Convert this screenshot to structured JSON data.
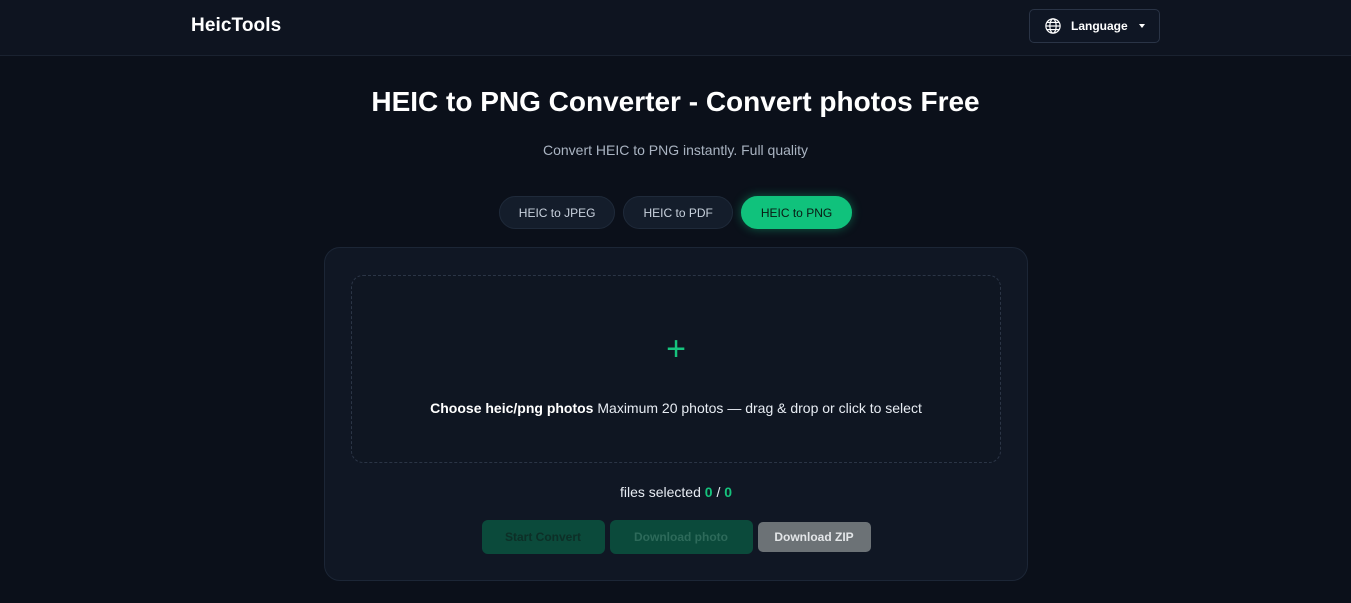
{
  "header": {
    "logo": "HeicTools",
    "language_label": "Language",
    "globe_icon": "globe-icon",
    "caret_icon": "caret-down-icon"
  },
  "hero": {
    "title": "HEIC to PNG Converter - Convert photos Free",
    "subtitle": "Convert HEIC to PNG instantly. Full quality"
  },
  "tabs": [
    {
      "label": "HEIC to JPEG",
      "active": false
    },
    {
      "label": "HEIC to PDF",
      "active": false
    },
    {
      "label": "HEIC to PNG",
      "active": true
    }
  ],
  "dropzone": {
    "plus_icon": "+",
    "bold_text": "Choose heic/png photos",
    "rest_text": "Maximum 20 photos — drag & drop or click to select"
  },
  "counter": {
    "label": "files selected",
    "selected": "0",
    "separator": "/",
    "total": "0"
  },
  "actions": {
    "start_label": "Start Convert",
    "download_photo_label": "Download photo",
    "download_zip_label": "Download ZIP"
  },
  "colors": {
    "accent": "#10c27c",
    "background": "#0b101a",
    "card": "#101724"
  }
}
